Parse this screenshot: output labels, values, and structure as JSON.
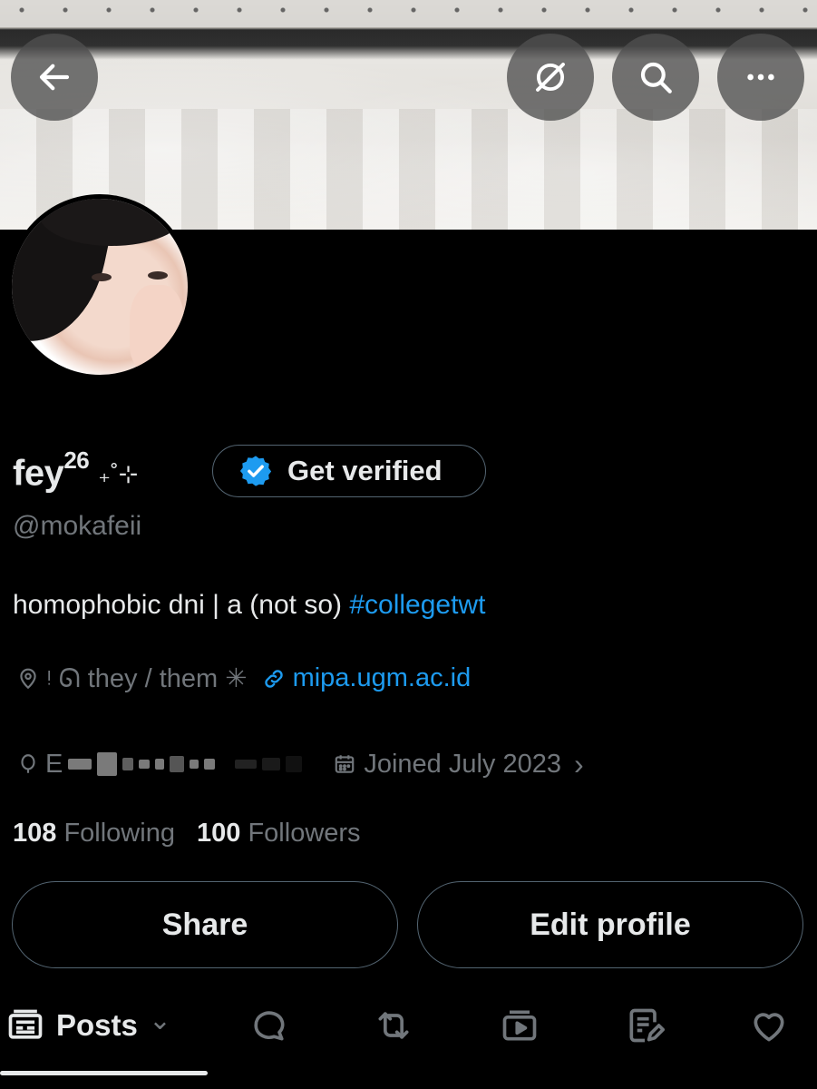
{
  "banner": {
    "alt": "header image"
  },
  "nav": {
    "back_icon": "arrow-left-icon",
    "grok_icon": "grok-icon",
    "search_icon": "search-icon",
    "more_icon": "more-icon"
  },
  "profile": {
    "display_name": "fey",
    "name_superscript": "26",
    "name_decoration": "₊˚⊹",
    "verify_label": "Get verified",
    "handle": "@mokafeii",
    "bio_text": "homophobic dni | a (not so) ",
    "bio_hashtag": "#collegetwt",
    "location": "ᵎ ᘏ they / them ✳︎",
    "website": "mipa.ugm.ac.id",
    "birthday_prefix": "E",
    "joined": "Joined July 2023",
    "joined_chevron": "›"
  },
  "stats": {
    "following_count": "108",
    "following_label": "Following",
    "followers_count": "100",
    "followers_label": "Followers"
  },
  "actions": {
    "share_label": "Share",
    "edit_label": "Edit profile"
  },
  "tabs": {
    "posts_label": "Posts",
    "posts_chevron": "⌄"
  },
  "colors": {
    "accent": "#1d9bf0",
    "muted": "#71767b",
    "text": "#e7e9ea",
    "border": "#536471",
    "background": "#000000"
  }
}
